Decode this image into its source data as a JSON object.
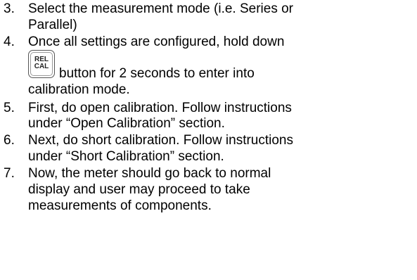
{
  "steps": [
    {
      "number": "3.",
      "lines": [
        "Select the measurement mode (i.e. Series or",
        "Parallel)"
      ]
    },
    {
      "number": "4.",
      "lines": [
        "Once all settings are configured, hold down"
      ]
    },
    {
      "button": {
        "top_label": "REL",
        "bottom_label": "CAL"
      },
      "after_button": "button for 2 seconds to enter into",
      "continuation": "calibration mode."
    },
    {
      "number": "5.",
      "lines": [
        "First, do open calibration.  Follow instructions",
        "under “Open Calibration” section."
      ]
    },
    {
      "number": "6.",
      "lines": [
        "Next, do short calibration.  Follow instructions",
        "under “Short Calibration” section."
      ]
    },
    {
      "number": "7.",
      "lines": [
        "Now, the meter should go back to normal",
        "display and user may proceed to take",
        "measurements of components."
      ]
    }
  ]
}
